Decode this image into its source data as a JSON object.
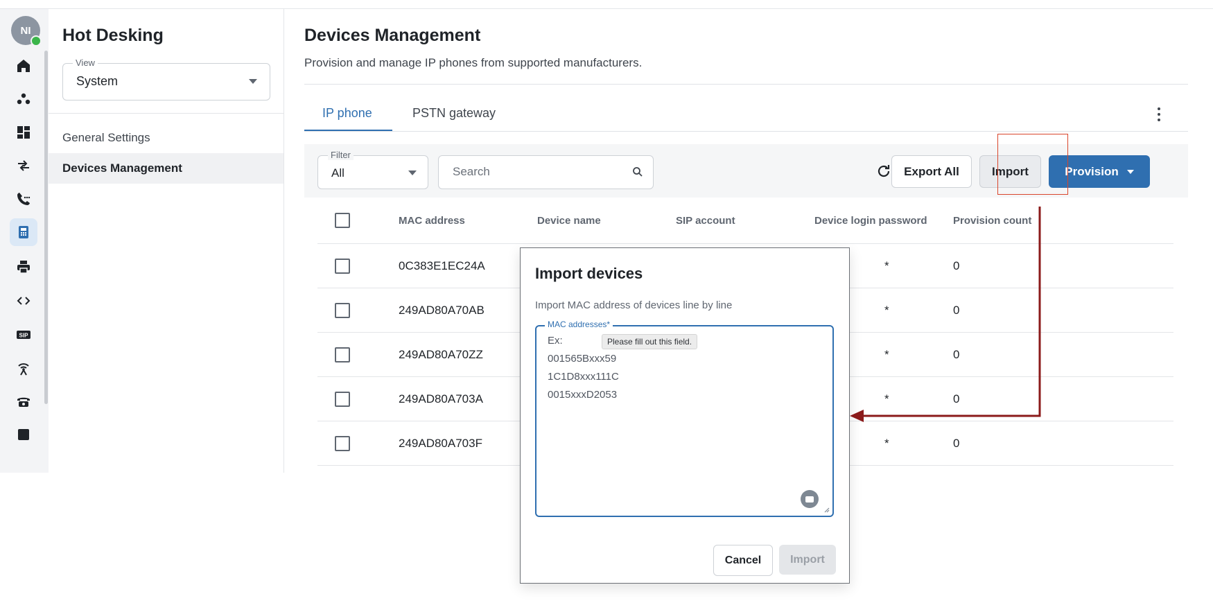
{
  "user": {
    "initials": "NI"
  },
  "rail": [
    {
      "icon": "home-icon"
    },
    {
      "icon": "team-icon"
    },
    {
      "icon": "dashboard-icon"
    },
    {
      "icon": "call-flow-icon"
    },
    {
      "icon": "call-log-icon"
    },
    {
      "icon": "phone-device-icon",
      "active": true
    },
    {
      "icon": "printer-icon"
    },
    {
      "icon": "code-icon"
    },
    {
      "icon": "sip-icon"
    },
    {
      "icon": "antenna-icon"
    },
    {
      "icon": "desk-phone-icon"
    }
  ],
  "sidebar": {
    "title": "Hot Desking",
    "view": {
      "label": "View",
      "value": "System"
    },
    "items": [
      {
        "label": "General Settings"
      },
      {
        "label": "Devices Management",
        "active": true
      }
    ]
  },
  "main": {
    "title": "Devices Management",
    "subtitle": "Provision and manage IP phones from supported manufacturers.",
    "tabs": [
      {
        "label": "IP phone",
        "active": true
      },
      {
        "label": "PSTN gateway"
      }
    ],
    "toolbar": {
      "filter_label": "Filter",
      "filter_value": "All",
      "search_placeholder": "Search",
      "export_label": "Export All",
      "import_label": "Import",
      "provision_label": "Provision"
    },
    "table": {
      "headers": [
        "MAC address",
        "Device name",
        "SIP account",
        "Device login password",
        "Provision count"
      ],
      "rows": [
        {
          "mac": "0C383E1EC24A",
          "count": "0"
        },
        {
          "mac": "249AD80A70AB",
          "count": "0"
        },
        {
          "mac": "249AD80A70ZZ",
          "count": "0"
        },
        {
          "mac": "249AD80A703A",
          "count": "0"
        },
        {
          "mac": "249AD80A703F",
          "count": "0"
        }
      ],
      "masked_symbol": "*"
    }
  },
  "dialog": {
    "title": "Import devices",
    "description": "Import MAC address of devices line by line",
    "field_label": "MAC addresses*",
    "placeholder_lines": [
      "Ex:",
      "001565Bxxx59",
      "1C1D8xxx111C",
      "0015xxxD2053"
    ],
    "tooltip": "Please fill out this field.",
    "cancel_label": "Cancel",
    "import_label": "Import"
  },
  "colors": {
    "accent": "#2f6fb0",
    "annotation": "#8b1a1a",
    "highlight": "#d9452b"
  }
}
